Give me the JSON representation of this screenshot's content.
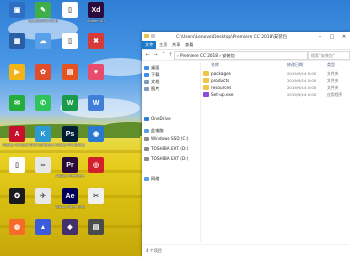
{
  "desktop": {
    "icons": [
      {
        "label": "",
        "color": "#2e6fc4",
        "glyph": "▣"
      },
      {
        "label": "CorelDRAW X8 (64-Bit)",
        "color": "#3fae48",
        "glyph": "✎"
      },
      {
        "label": "",
        "color": "#ffffff",
        "glyph": "▯"
      },
      {
        "label": "Adobe XD",
        "color": "#2b0a3d",
        "glyph": "Xd"
      },
      {
        "label": "",
        "color": "#2a5fa5",
        "glyph": "▦"
      },
      {
        "label": "",
        "color": "#5aa0e8",
        "glyph": "☁"
      },
      {
        "label": "",
        "color": "#ffffff",
        "glyph": "▯"
      },
      {
        "label": "",
        "color": "#d83a3a",
        "glyph": "✖"
      },
      {
        "label": "",
        "color": "#f3b418",
        "glyph": "▶"
      },
      {
        "label": "",
        "color": "#e14d2a",
        "glyph": "✿"
      },
      {
        "label": "",
        "color": "#e3521f",
        "glyph": "▤"
      },
      {
        "label": "",
        "color": "#e74c6c",
        "glyph": "♥"
      },
      {
        "label": "",
        "color": "#23ad3a",
        "glyph": "✉"
      },
      {
        "label": "",
        "color": "#2ec45a",
        "glyph": "✆"
      },
      {
        "label": "",
        "color": "#1a9a4a",
        "glyph": "W"
      },
      {
        "label": "",
        "color": "#3f7fd8",
        "glyph": "W"
      },
      {
        "label": "Adobe Acrobat DC",
        "color": "#c8102e",
        "glyph": "A"
      },
      {
        "label": "Kill Software",
        "color": "#2c9ad4",
        "glyph": "K"
      },
      {
        "label": "Adobe Photoshop",
        "color": "#001e36",
        "glyph": "Ps"
      },
      {
        "label": "",
        "color": "#2a78d0",
        "glyph": "◉"
      },
      {
        "label": "",
        "color": "#ffffff",
        "glyph": "▯"
      },
      {
        "label": "",
        "color": "#e8e8e8",
        "glyph": "∞"
      },
      {
        "label": "Adobe Premiere",
        "color": "#2a0a3a",
        "glyph": "Pr"
      },
      {
        "label": "",
        "color": "#d1202a",
        "glyph": "◎"
      },
      {
        "label": "",
        "color": "#1b1b1b",
        "glyph": "✪"
      },
      {
        "label": "",
        "color": "#e8e8e8",
        "glyph": "✈"
      },
      {
        "label": "Adobe After Effects",
        "color": "#00005b",
        "glyph": "Ae"
      },
      {
        "label": "",
        "color": "#f0f0f0",
        "glyph": "✂"
      },
      {
        "label": "",
        "color": "#f56b2a",
        "glyph": "◍"
      },
      {
        "label": "",
        "color": "#3b5bdb",
        "glyph": "▲"
      },
      {
        "label": "",
        "color": "#44306a",
        "glyph": "◆"
      },
      {
        "label": "",
        "color": "#4b4b4b",
        "glyph": "▤"
      }
    ]
  },
  "window": {
    "title": "C:\\Users\\Lenovo\\Desktop\\Premiere CC 2018\\安装包",
    "minimize_icon": "minimize-icon",
    "maximize_icon": "maximize-icon",
    "close_icon": "close-icon",
    "ribbon_tabs": [
      "文件",
      "主页",
      "共享",
      "查看"
    ],
    "address": "›  Premiere CC 2018  ›  安装包",
    "search_placeholder": "搜索\"安装包\"",
    "nav_items": [
      {
        "label": "桌面",
        "color": "#3a8ee6"
      },
      {
        "label": "下载",
        "color": "#3a8ee6"
      },
      {
        "label": "文档",
        "color": "#7f9bb8"
      },
      {
        "label": "图片",
        "color": "#7f9bb8"
      },
      {
        "label": "OneDrive",
        "color": "#2f7fd6"
      },
      {
        "label": "此电脑",
        "color": "#5d9fdc"
      },
      {
        "label": "Windows SSD (C:)",
        "color": "#8c8c8c"
      },
      {
        "label": "TOSHIBA EXT (D:)",
        "color": "#8c8c8c"
      },
      {
        "label": "TOSHIBA EXT (D:)",
        "color": "#8c8c8c"
      },
      {
        "label": "网络",
        "color": "#5d9fdc"
      }
    ],
    "columns": {
      "name": "名称",
      "date": "修改日期",
      "type": "类型"
    },
    "files": [
      {
        "name": "packages",
        "date": "2019/9/14 0:00",
        "type": "文件夹",
        "color": "#f0c64a"
      },
      {
        "name": "products",
        "date": "2019/9/14 0:00",
        "type": "文件夹",
        "color": "#f0c64a"
      },
      {
        "name": "resources",
        "date": "2019/9/14 0:00",
        "type": "文件夹",
        "color": "#f0c64a"
      },
      {
        "name": "Set-up.exe",
        "date": "2019/9/14 0:00",
        "type": "应用程序",
        "color": "#8a4bd6"
      }
    ],
    "status": "4 个项目"
  }
}
